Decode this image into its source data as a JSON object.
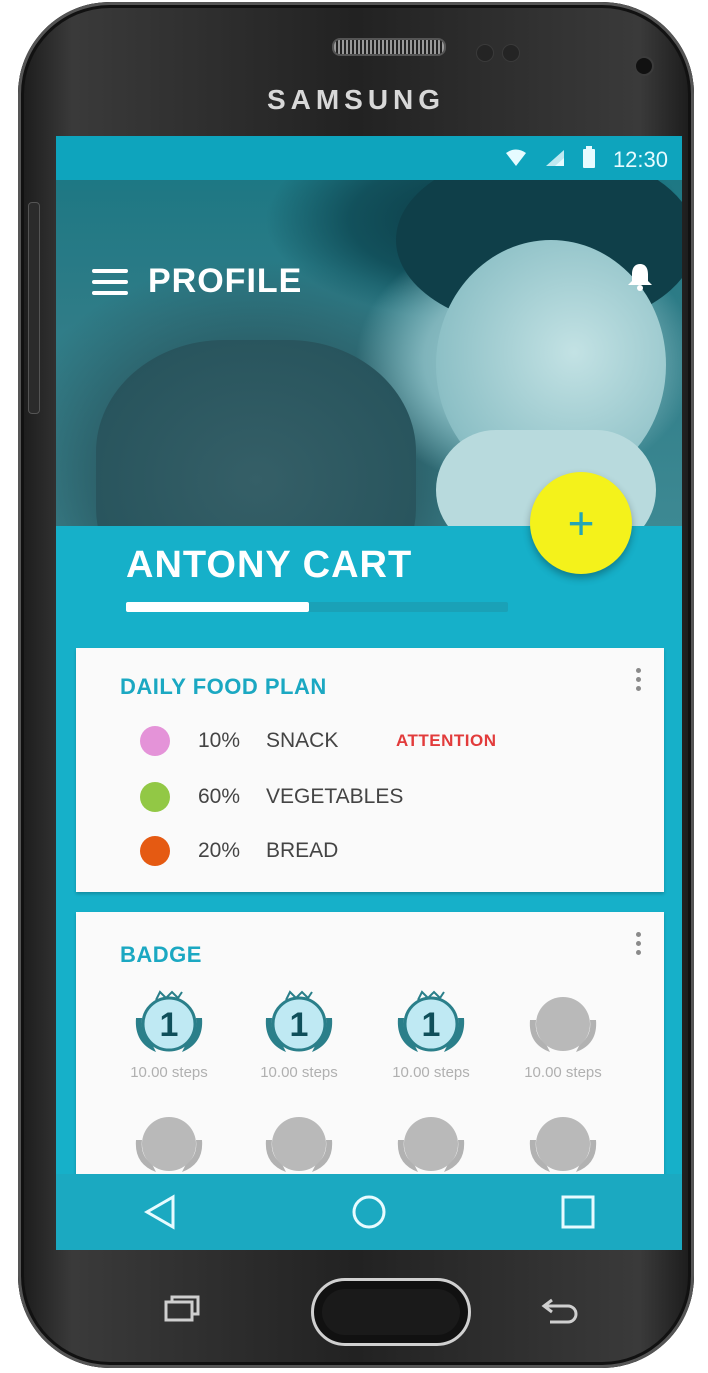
{
  "device": {
    "brand": "SAMSUNG"
  },
  "status_bar": {
    "time": "12:30"
  },
  "header": {
    "title": "PROFILE"
  },
  "profile": {
    "name": "ANTONY CART",
    "progress": 0.48
  },
  "fab": {
    "label": "+"
  },
  "food_plan": {
    "title": "DAILY FOOD PLAN",
    "items": [
      {
        "percent": "10%",
        "name": "SNACK",
        "warning": "ATTENTION",
        "color": "#e493d8"
      },
      {
        "percent": "60%",
        "name": "VEGETABLES",
        "warning": "",
        "color": "#92c845"
      },
      {
        "percent": "20%",
        "name": "BREAD",
        "warning": "",
        "color": "#e55a12"
      }
    ]
  },
  "badges": {
    "title": "BADGE",
    "items": [
      {
        "number": "1",
        "caption": "10.00 steps",
        "unlocked": true
      },
      {
        "number": "1",
        "caption": "10.00 steps",
        "unlocked": true
      },
      {
        "number": "1",
        "caption": "10.00 steps",
        "unlocked": true
      },
      {
        "number": "",
        "caption": "10.00 steps",
        "unlocked": false
      },
      {
        "number": "",
        "caption": "",
        "unlocked": false
      },
      {
        "number": "",
        "caption": "",
        "unlocked": false
      },
      {
        "number": "",
        "caption": "",
        "unlocked": false
      },
      {
        "number": "",
        "caption": "",
        "unlocked": false
      }
    ]
  },
  "navigation": {
    "icons": [
      "back-icon",
      "home-icon",
      "recents-icon"
    ]
  },
  "colors": {
    "accent": "#16b0c9",
    "fab": "#f4f21b",
    "warning": "#e23b3b"
  }
}
